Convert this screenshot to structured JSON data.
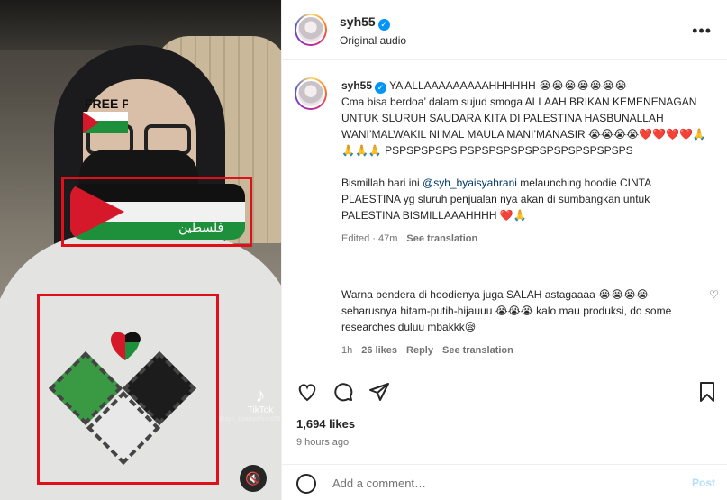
{
  "post": {
    "username": "syh55",
    "audio": "Original audio",
    "more": "•••"
  },
  "media": {
    "sticker_text": "FREE PALESTINE",
    "mask_text": "فلسطين",
    "tiktok_label": "TikTok",
    "tiktok_user": "@syh_byaisyahrani55",
    "mute_icon": "speaker-muted-icon"
  },
  "caption": {
    "username": "syh55",
    "line1": "YA ALLAAAAAAAAAHHHHHH 😭😭😭😭😭😭😭",
    "line2": "Cma bisa berdoa’ dalam sujud smoga ALLAAH BRIKAN KEMENENAGAN UNTUK SLURUH SAUDARA KITA DI PALESTINA HASBUNALLAH WANI’MALWAKIL NI’MAL MAULA MANI’MANASIR 😭😭😭😭❤️❤️❤️❤️🙏🙏🙏🙏 PSPSPSPSPS PSPSPSPSPSPSPSPSPSPSPSPS",
    "p2_pre": "Bismillah hari ini ",
    "p2_tag": "@syh_byaisyahrani",
    "p2_post": " melaunching hoodie CINTA PLAESTINA yg sluruh penjualan nya akan di sumbangkan untuk PALESTINA BISMILLAAAHHHH ❤️🙏",
    "edited": "Edited · 47m",
    "see_translation": "See translation"
  },
  "comment": {
    "text": "Warna bendera di hoodienya juga SALAH astagaaaa 😭😭😭😭 seharusnya hitam-putih-hijauuu 😭😭😭 kalo mau produksi, do some researches duluu mbakkk😪",
    "time": "1h",
    "likes": "26 likes",
    "reply": "Reply",
    "see_translation": "See translation"
  },
  "actions": {
    "likes": "1,694 likes",
    "ago": "9 hours ago"
  },
  "add_comment": {
    "placeholder": "Add a comment…",
    "post": "Post"
  }
}
